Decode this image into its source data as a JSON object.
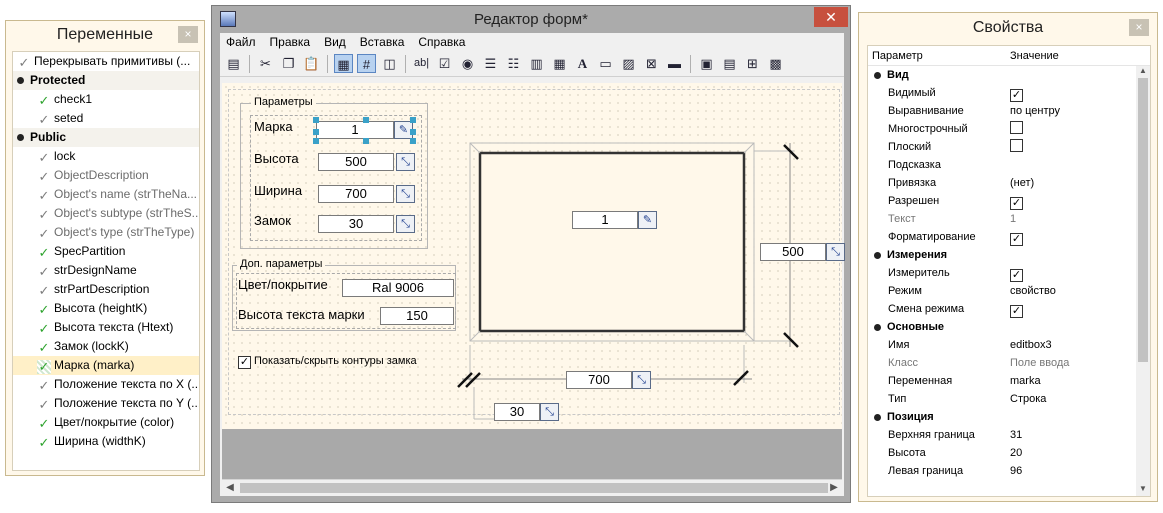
{
  "variables_panel": {
    "title": "Переменные",
    "close": "×",
    "items": [
      {
        "label": "Перекрывать примитивы (...",
        "type": "item",
        "icon": "check-gray"
      },
      {
        "label": "Protected",
        "type": "group"
      },
      {
        "label": "check1",
        "type": "sub",
        "icon": "check-green"
      },
      {
        "label": "seted",
        "type": "sub",
        "icon": "check-gray"
      },
      {
        "label": "Public",
        "type": "group"
      },
      {
        "label": "lock",
        "type": "sub",
        "icon": "check-gray"
      },
      {
        "label": "ObjectDescription",
        "type": "sub-grey",
        "icon": "check-gray"
      },
      {
        "label": "Object's name (strTheNa...",
        "type": "sub-grey",
        "icon": "check-gray"
      },
      {
        "label": "Object's subtype (strTheS...",
        "type": "sub-grey",
        "icon": "check-gray"
      },
      {
        "label": "Object's type (strTheType)",
        "type": "sub-grey",
        "icon": "check-gray"
      },
      {
        "label": "SpecPartition",
        "type": "sub",
        "icon": "check-green"
      },
      {
        "label": "strDesignName",
        "type": "sub",
        "icon": "check-gray"
      },
      {
        "label": "strPartDescription",
        "type": "sub",
        "icon": "check-gray"
      },
      {
        "label": "Высота (heightK)",
        "type": "sub",
        "icon": "check-green"
      },
      {
        "label": "Высота текста (Htext)",
        "type": "sub",
        "icon": "check-green"
      },
      {
        "label": "Замок (lockK)",
        "type": "sub",
        "icon": "check-green"
      },
      {
        "label": "Марка (marka)",
        "type": "sub-sel",
        "icon": "check-dot"
      },
      {
        "label": "Положение текста по X (...",
        "type": "sub",
        "icon": "check-gray"
      },
      {
        "label": "Положение текста по Y (...",
        "type": "sub",
        "icon": "check-gray"
      },
      {
        "label": "Цвет/покрытие (color)",
        "type": "sub",
        "icon": "check-green"
      },
      {
        "label": "Ширина (widthK)",
        "type": "sub",
        "icon": "check-green"
      }
    ]
  },
  "editor": {
    "title": "Редактор форм*",
    "close": "✕",
    "menu": [
      "Файл",
      "Правка",
      "Вид",
      "Вставка",
      "Справка"
    ],
    "form": {
      "params_group": "Параметры",
      "marka_label": "Марка",
      "marka_value": "1",
      "height_label": "Высота",
      "height_value": "500",
      "width_label": "Ширина",
      "width_value": "700",
      "lock_label": "Замок",
      "lock_value": "30",
      "extra_group": "Доп. параметры",
      "color_label": "Цвет/покрытие",
      "color_value": "Ral 9006",
      "text_height_label": "Высота текста марки",
      "text_height_value": "150",
      "contour_checkbox": "Показать/скрыть контуры замка",
      "drawing_marka": "1",
      "drawing_height": "500",
      "drawing_width": "700",
      "drawing_lock": "30"
    }
  },
  "properties_panel": {
    "title": "Свойства",
    "close": "×",
    "col_param": "Параметр",
    "col_value": "Значение",
    "rows": [
      {
        "k": "Вид",
        "v": "",
        "kind": "section"
      },
      {
        "k": "Видимый",
        "v": "",
        "kind": "check",
        "checked": true
      },
      {
        "k": "Выравнивание",
        "v": "по центру",
        "kind": "text"
      },
      {
        "k": "Многострочный",
        "v": "",
        "kind": "check",
        "checked": false
      },
      {
        "k": "Плоский",
        "v": "",
        "kind": "check",
        "checked": false
      },
      {
        "k": "Подсказка",
        "v": "",
        "kind": "text"
      },
      {
        "k": "Привязка",
        "v": "(нет)",
        "kind": "text"
      },
      {
        "k": "Разрешен",
        "v": "",
        "kind": "check",
        "checked": true
      },
      {
        "k": "Текст",
        "v": "1",
        "kind": "grey"
      },
      {
        "k": "Форматирование",
        "v": "",
        "kind": "check",
        "checked": true
      },
      {
        "k": "Измерения",
        "v": "",
        "kind": "section"
      },
      {
        "k": "Измеритель",
        "v": "",
        "kind": "check",
        "checked": true
      },
      {
        "k": "Режим",
        "v": "свойство",
        "kind": "text"
      },
      {
        "k": "Смена режима",
        "v": "",
        "kind": "check",
        "checked": true
      },
      {
        "k": "Основные",
        "v": "",
        "kind": "section"
      },
      {
        "k": "Имя",
        "v": "editbox3",
        "kind": "text"
      },
      {
        "k": "Класс",
        "v": "Поле ввода",
        "kind": "grey"
      },
      {
        "k": "Переменная",
        "v": "marka",
        "kind": "text"
      },
      {
        "k": "Тип",
        "v": "Строка",
        "kind": "text"
      },
      {
        "k": "Позиция",
        "v": "",
        "kind": "section"
      },
      {
        "k": "Верхняя граница",
        "v": "31",
        "kind": "text"
      },
      {
        "k": "Высота",
        "v": "20",
        "kind": "text"
      },
      {
        "k": "Левая граница",
        "v": "96",
        "kind": "text"
      }
    ]
  }
}
